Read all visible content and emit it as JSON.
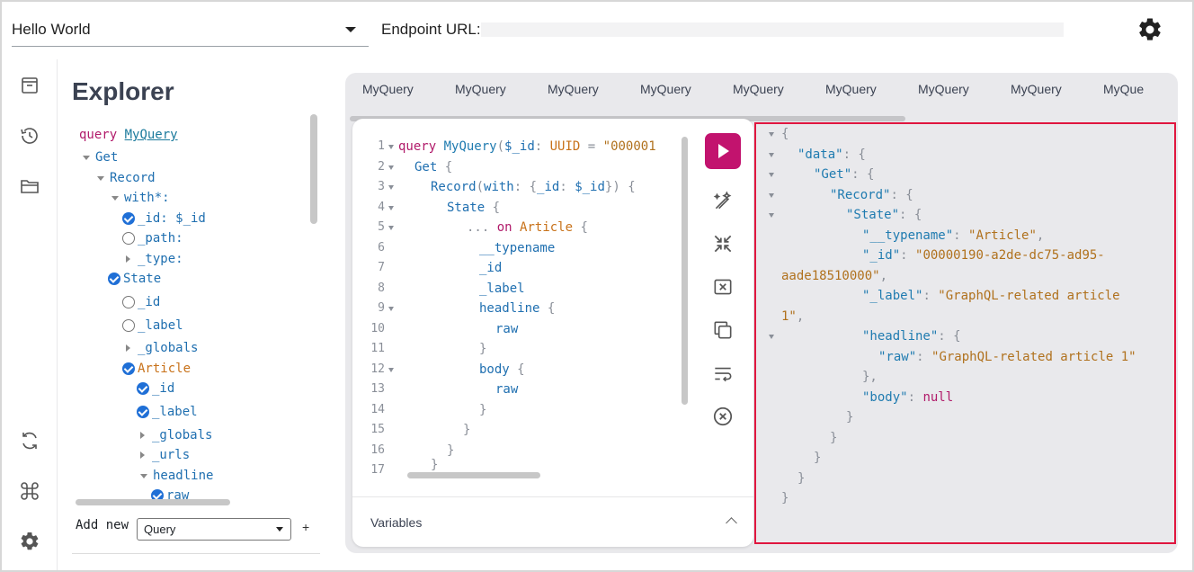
{
  "topbar": {
    "project": "Hello World",
    "endpoint_label": "Endpoint URL:",
    "endpoint_value": ""
  },
  "explorer": {
    "title": "Explorer",
    "query_kw": "query",
    "query_name": "MyQuery",
    "tree": [
      {
        "text": "Get",
        "kind": "field"
      },
      {
        "text": "Record",
        "kind": "field"
      },
      {
        "text": "with*:",
        "kind": "field"
      },
      {
        "text": "_id: $_id",
        "kind": "field"
      },
      {
        "text": "_path:",
        "kind": "field"
      },
      {
        "text": "_type:",
        "kind": "field"
      },
      {
        "text": "State",
        "kind": "field"
      },
      {
        "text": "_id",
        "kind": "field"
      },
      {
        "text": "_label",
        "kind": "field"
      },
      {
        "text": "_globals",
        "kind": "field"
      },
      {
        "text": "Article",
        "kind": "frag"
      },
      {
        "text": "_id",
        "kind": "field"
      },
      {
        "text": "_label",
        "kind": "field"
      },
      {
        "text": "_globals",
        "kind": "field"
      },
      {
        "text": "_urls",
        "kind": "field"
      },
      {
        "text": "headline",
        "kind": "field"
      },
      {
        "text": "raw",
        "kind": "field"
      }
    ],
    "add_label": "Add new",
    "add_select_value": "Query",
    "add_plus": "+"
  },
  "tabs": [
    "MyQuery",
    "MyQuery",
    "MyQuery",
    "MyQuery",
    "MyQuery",
    "MyQuery",
    "MyQuery",
    "MyQuery",
    "MyQue"
  ],
  "editor": {
    "line_numbers": [
      "1",
      "2",
      "3",
      "4",
      "5",
      "6",
      "7",
      "8",
      "9",
      "10",
      "11",
      "12",
      "13",
      "14",
      "15",
      "16",
      "17"
    ],
    "lines": [
      [
        "query",
        " ",
        "MyQuery",
        "(",
        "$_id",
        ": ",
        "UUID",
        " = ",
        "\"000001"
      ],
      [
        "Get",
        " {"
      ],
      [
        "Record",
        "(",
        "with",
        ": {",
        "_id",
        ": ",
        "$_id",
        "}) {"
      ],
      [
        "State",
        " {"
      ],
      [
        "...",
        " ",
        "on",
        " ",
        "Article",
        " {"
      ],
      [
        "__typename"
      ],
      [
        "_id"
      ],
      [
        "_label"
      ],
      [
        "headline",
        " {"
      ],
      [
        "raw"
      ],
      [
        "}"
      ],
      [
        "body",
        " {"
      ],
      [
        "raw"
      ],
      [
        "}"
      ],
      [
        "}"
      ],
      [
        "}"
      ],
      [
        "}"
      ]
    ],
    "variables_label": "Variables"
  },
  "result": {
    "lines": [
      [
        "{"
      ],
      [
        "\"data\"",
        ": {"
      ],
      [
        "\"Get\"",
        ": {"
      ],
      [
        "\"Record\"",
        ": {"
      ],
      [
        "\"State\"",
        ": {"
      ],
      [
        "\"__typename\"",
        ": ",
        "\"Article\"",
        ","
      ],
      [
        "\"_id\"",
        ": ",
        "\"00000190-a2de-dc75-ad95-"
      ],
      [
        "aade18510000\"",
        ","
      ],
      [
        "\"_label\"",
        ": ",
        "\"GraphQL-related article"
      ],
      [
        "1\"",
        ","
      ],
      [
        "\"headline\"",
        ": {"
      ],
      [
        "\"raw\"",
        ": ",
        "\"GraphQL-related article 1\""
      ],
      [
        "},"
      ],
      [
        "\"body\"",
        ": ",
        "null"
      ],
      [
        "}"
      ],
      [
        "}"
      ],
      [
        "}"
      ],
      [
        "}"
      ],
      [
        "}"
      ]
    ]
  },
  "colors": {
    "run": "#c2136e",
    "highlight_border": "#e0163f",
    "checked": "#1f6fd6"
  },
  "icons": [
    "settings-gear-icon",
    "archive-icon",
    "history-icon",
    "folder-icon",
    "refresh-icon",
    "command-icon",
    "settings-icon",
    "prettify-icon",
    "merge-icon",
    "copy-icon",
    "wrap-icon",
    "close-circle-icon"
  ]
}
